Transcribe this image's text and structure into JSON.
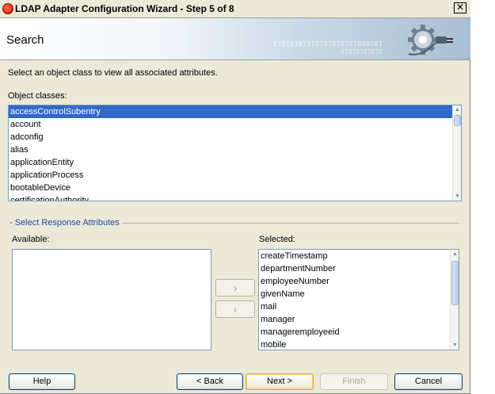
{
  "window": {
    "title": "LDAP Adapter Configuration Wizard - Step 5 of 8",
    "close_glyph": "✕"
  },
  "banner": {
    "title": "Search",
    "binary_line1": "01010101010101010101010101",
    "binary_line2": "01010101010"
  },
  "instruction": "Select an object class to view all associated attributes.",
  "object_classes": {
    "label": "Object classes:",
    "items": [
      "accessControlSubentry",
      "account",
      "adconfig",
      "alias",
      "applicationEntity",
      "applicationProcess",
      "bootableDevice",
      "certificationAuthority"
    ],
    "selected_index": 0
  },
  "response_attributes": {
    "group_label": "- Select Response Attributes",
    "available_label": "Available:",
    "selected_label": "Selected:",
    "available_items": [],
    "selected_items": [
      "createTimestamp",
      "departmentNumber",
      "employeeNumber",
      "givenName",
      "mail",
      "manager",
      "manageremployeeid",
      "mobile"
    ],
    "move_right": "›",
    "move_left": "‹"
  },
  "buttons": {
    "help": "Help",
    "back": "< Back",
    "next": "Next >",
    "finish": "Finish",
    "cancel": "Cancel"
  }
}
